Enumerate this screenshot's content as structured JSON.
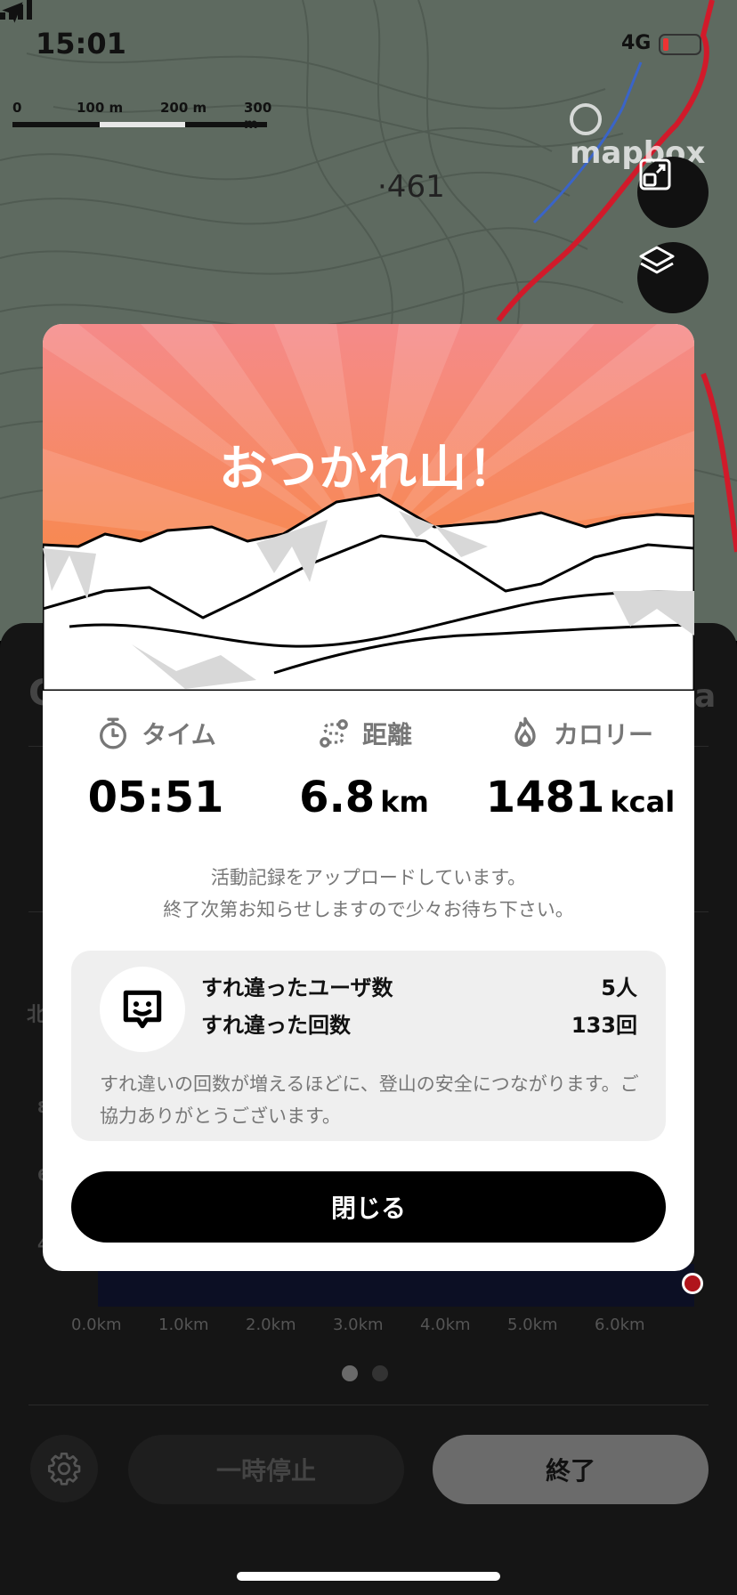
{
  "status_bar": {
    "time": "15:01",
    "network": "4G"
  },
  "map": {
    "scale_labels": [
      "0",
      "100 m",
      "200 m",
      "300 m"
    ],
    "attribution": "mapbox",
    "elevation_label": "·461"
  },
  "modal": {
    "title": "おつかれ山！",
    "stats": [
      {
        "icon": "stopwatch-icon",
        "label": "タイム",
        "value": "05:51",
        "unit": ""
      },
      {
        "icon": "route-icon",
        "label": "距離",
        "value": "6.8",
        "unit": "km"
      },
      {
        "icon": "flame-icon",
        "label": "カロリー",
        "value": "1481",
        "unit": "kcal"
      }
    ],
    "message_line1": "活動記録をアップロードしています。",
    "message_line2": "終了次第お知らせしますので少々お待ち下さい。",
    "encounter": {
      "users_label": "すれ違ったユーザ数",
      "users_value": "5人",
      "count_label": "すれ違った回数",
      "count_value": "133回",
      "note": "すれ違いの回数が増えるほどに、登山の安全につながります。ご協力ありがとうございます。"
    },
    "close_label": "閉じる"
  },
  "sheet": {
    "distance_ticks": [
      "0.0km",
      "1.0km",
      "2.0km",
      "3.0km",
      "4.0km",
      "5.0km",
      "6.0km"
    ],
    "page_indicator": {
      "pages": 2,
      "current": 1
    },
    "pause_label": "一時停止",
    "end_label": "終了"
  },
  "colors": {
    "hero_top": "#f58a8a",
    "hero_bottom": "#f9882e",
    "route": "#d11a2a",
    "accent_dark": "#000000"
  }
}
